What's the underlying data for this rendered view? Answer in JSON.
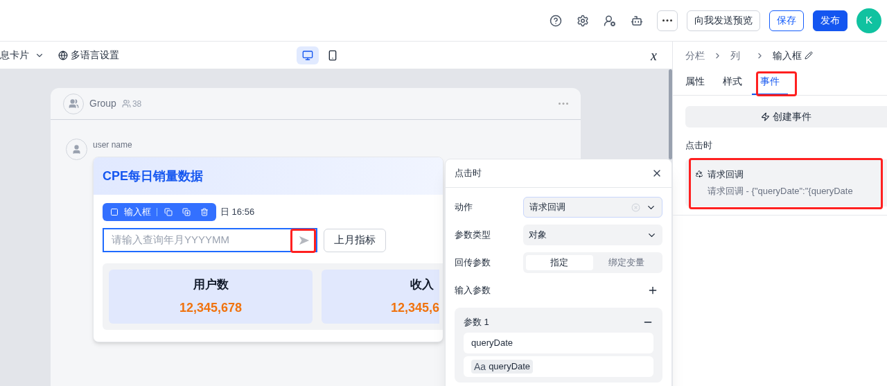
{
  "header": {
    "buttons": [
      {
        "label": "向我发送预览",
        "kind": "outline"
      },
      {
        "label": "保存",
        "kind": "primary-outline"
      },
      {
        "label": "发布",
        "kind": "primary"
      }
    ],
    "avatar": "K"
  },
  "toolbar": {
    "card_type": "息卡片",
    "language": "多语言设置",
    "modes": [
      {
        "kind": "desktop",
        "selected": true
      },
      {
        "kind": "mobile",
        "selected": false
      }
    ],
    "variable_symbol": "x"
  },
  "canvas": {
    "group": {
      "name": "Group",
      "members": "38"
    },
    "sender": "user name",
    "message": {
      "title": "CPE每日销量数据",
      "timestamp": "日 16:56",
      "component_toolbar": "输入框",
      "input": {
        "placeholder": "请输入查询年月YYYYMM"
      },
      "button": "上月指标",
      "metrics": [
        {
          "label": "用户数",
          "value": "12,345,678"
        },
        {
          "label": "收入",
          "value": "12,345,6"
        }
      ]
    }
  },
  "popover": {
    "title": "点击时",
    "action": {
      "label": "动作",
      "value": "请求回调"
    },
    "param_type": {
      "label": "参数类型",
      "value": "对象"
    },
    "return_params": {
      "label": "回传参数",
      "options": [
        {
          "label": "指定",
          "selected": true
        },
        {
          "label": "绑定变量",
          "selected": false
        }
      ]
    },
    "input_params": {
      "label": "输入参数",
      "params": [
        {
          "title": "参数 1",
          "name": "queryDate",
          "type_symbol": "Aa",
          "value_tag": "queryDate"
        }
      ]
    }
  },
  "panel": {
    "breadcrumbs": [
      "分栏",
      "列",
      "输入框"
    ],
    "tabs": [
      {
        "label": "属性",
        "selected": false
      },
      {
        "label": "样式",
        "selected": false
      },
      {
        "label": "事件",
        "selected": true
      }
    ],
    "create_button": "创建事件",
    "section": "点击时",
    "events": [
      {
        "title": "请求回调",
        "detail": "请求回调 - {\"queryDate\":\"{queryDate"
      }
    ]
  }
}
